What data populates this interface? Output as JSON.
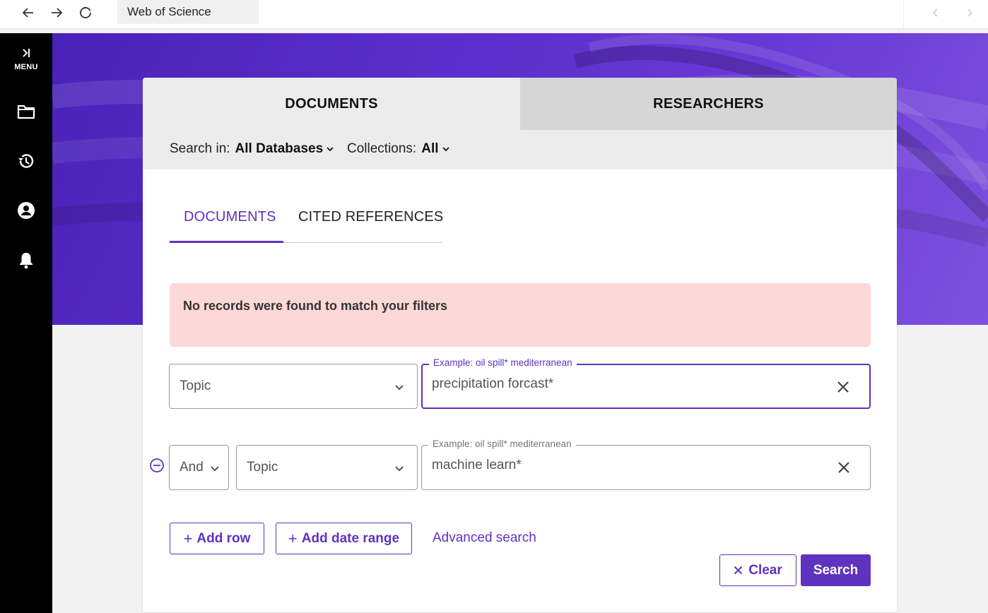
{
  "browser": {
    "back_icon": "arrow-left-icon",
    "forward_icon": "arrow-right-icon",
    "reload_icon": "reload-icon",
    "tab_title": "Web of Science"
  },
  "sidebar": {
    "menu_label": "MENU",
    "items": [
      {
        "icon": "folder-icon"
      },
      {
        "icon": "history-icon"
      },
      {
        "icon": "account-icon"
      },
      {
        "icon": "bell-icon"
      }
    ]
  },
  "tabs": {
    "documents": "DOCUMENTS",
    "researchers": "RESEARCHERS"
  },
  "filters": {
    "search_in_label": "Search in:",
    "search_in_value": "All Databases",
    "collections_label": "Collections:",
    "collections_value": "All"
  },
  "subtabs": {
    "documents": "DOCUMENTS",
    "cited_references": "CITED REFERENCES"
  },
  "alert": {
    "message": "No records were found to match your filters"
  },
  "rows": [
    {
      "field": "Topic",
      "placeholder": "Example: oil spill* mediterranean",
      "value": "precipitation forcast*"
    },
    {
      "operator": "And",
      "field": "Topic",
      "placeholder": "Example: oil spill* mediterranean",
      "value": "machine learn*"
    }
  ],
  "actions": {
    "add_row": "Add row",
    "add_date_range": "Add date range",
    "advanced_search": "Advanced search",
    "clear": "Clear",
    "search": "Search"
  },
  "colors": {
    "accent": "#5e33bf",
    "banner": "#5b2fcb",
    "alert_bg": "#fdd8d8"
  }
}
